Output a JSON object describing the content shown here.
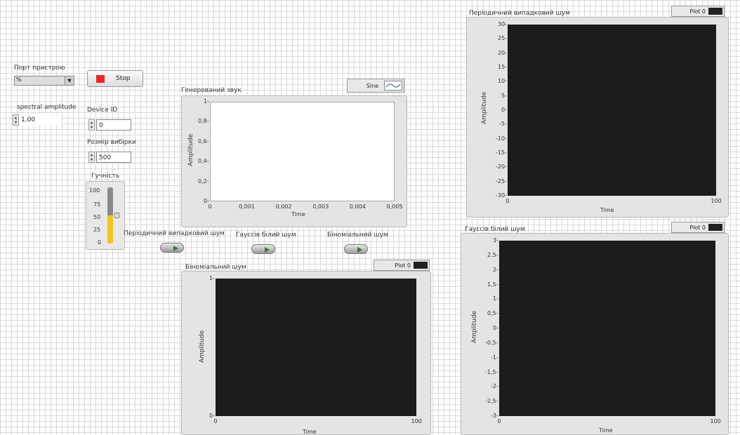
{
  "device_port": {
    "label": "Порт пристрою",
    "value": "%"
  },
  "stop_button": {
    "label": "Stop"
  },
  "spectral_amplitude": {
    "label": "spectral amplitude",
    "value": "1,00"
  },
  "device_id": {
    "label": "Device ID",
    "value": "0"
  },
  "sample_size": {
    "label": "Розмір вибірки",
    "value": "500"
  },
  "loudness": {
    "label": "Гучність",
    "ticks": [
      "100",
      "75",
      "50",
      "25",
      "0"
    ],
    "level": 0.5
  },
  "generated_sound": {
    "title": "Генерований звук",
    "legend": "Sine",
    "ylabel": "Amplitude",
    "xlabel": "Time",
    "yticks": [
      "1",
      "0,8",
      "0,6",
      "0,4",
      "0,2",
      "0"
    ],
    "xticks": [
      "0",
      "0,001",
      "0,002",
      "0,003",
      "0,004",
      "0,005"
    ]
  },
  "periodic_noise": {
    "title": "Періодичний випадковий шум",
    "legend": "Plot 0",
    "ylabel": "Amplitude",
    "xlabel": "Time",
    "yticks": [
      "30",
      "25",
      "20",
      "15",
      "10",
      "5",
      "0",
      "-5",
      "-10",
      "-15",
      "-20",
      "-25",
      "-30"
    ],
    "xticks": [
      "0",
      "100"
    ]
  },
  "gaussian_noise": {
    "title": "Гауссів білий шум",
    "legend": "Plot 0",
    "ylabel": "Amplitude",
    "xlabel": "Time",
    "yticks": [
      "3",
      "2,5",
      "2",
      "1,5",
      "1",
      "0,5",
      "0",
      "-0,5",
      "-1",
      "-1,5",
      "-2",
      "-2,5",
      "-3"
    ],
    "xticks": [
      "0",
      "100"
    ]
  },
  "binomial_noise": {
    "title": "Біноміальний шум",
    "legend": "Plot 0",
    "ylabel": "Amplitude",
    "xlabel": "Time",
    "yticks": [
      "1",
      "0"
    ],
    "xticks": [
      "0",
      "100"
    ]
  },
  "switches": {
    "periodic": "Періодичний випадковий шум",
    "gaussian": "Гауссів білий шум",
    "binomial": "Біноміальний шум"
  },
  "colors": {
    "plot_bg": "#1c1c1c",
    "stop_led": "#e8262b",
    "switch_led": "#2f7d2f",
    "level_fill": "#f5c518"
  }
}
